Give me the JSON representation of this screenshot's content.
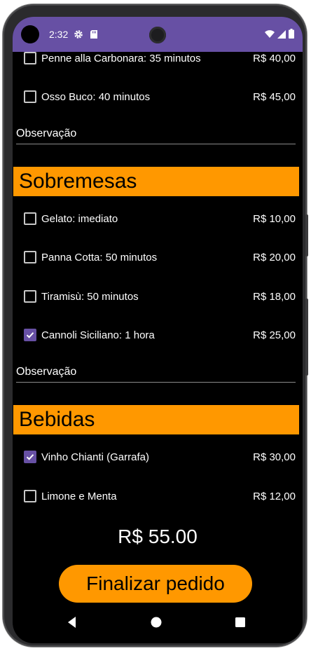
{
  "status_bar": {
    "time": "2:32",
    "left_icons": [
      "gear-icon",
      "sd-card-icon"
    ],
    "right_icons": [
      "wifi-icon",
      "signal-icon",
      "battery-icon"
    ],
    "background": "#6750a4"
  },
  "previous_section": {
    "items": [
      {
        "label": "Penne alla Carbonara: 35 minutos",
        "price": "R$ 40,00",
        "checked": false
      },
      {
        "label": "Osso Buco: 40 minutos",
        "price": "R$ 45,00",
        "checked": false
      }
    ],
    "observation_label": "Observação"
  },
  "desserts": {
    "title": "Sobremesas",
    "items": [
      {
        "label": "Gelato: imediato",
        "price": "R$ 10,00",
        "checked": false
      },
      {
        "label": "Panna Cotta: 50 minutos",
        "price": "R$ 20,00",
        "checked": false
      },
      {
        "label": "Tiramisù: 50 minutos",
        "price": "R$ 18,00",
        "checked": false
      },
      {
        "label": "Cannoli Siciliano: 1 hora",
        "price": "R$ 25,00",
        "checked": true
      }
    ],
    "observation_label": "Observação"
  },
  "drinks": {
    "title": "Bebidas",
    "items": [
      {
        "label": "Vinho Chianti (Garrafa)",
        "price": "R$ 30,00",
        "checked": true
      },
      {
        "label": "Limone e Menta",
        "price": "R$ 12,00",
        "checked": false
      }
    ]
  },
  "total": "R$ 55.00",
  "finalize_button": "Finalizar pedido",
  "navigation": [
    "back-icon",
    "home-icon",
    "recents-icon"
  ],
  "colors": {
    "accent": "#ff9800",
    "checkbox_checked": "#6750a4",
    "background": "#000000",
    "text": "#ffffff"
  }
}
